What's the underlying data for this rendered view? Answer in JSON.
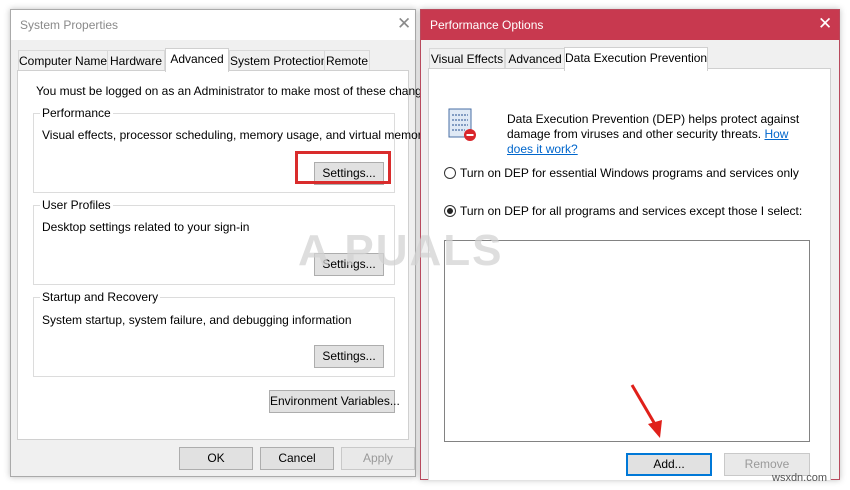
{
  "system_properties": {
    "title": "System Properties",
    "tabs": [
      {
        "label": "Computer Name",
        "active": false
      },
      {
        "label": "Hardware",
        "active": false
      },
      {
        "label": "Advanced",
        "active": true
      },
      {
        "label": "System Protection",
        "active": false
      },
      {
        "label": "Remote",
        "active": false
      }
    ],
    "admin_note": "You must be logged on as an Administrator to make most of these changes.",
    "performance": {
      "legend": "Performance",
      "description": "Visual effects, processor scheduling, memory usage, and virtual memory",
      "button": "Settings..."
    },
    "user_profiles": {
      "legend": "User Profiles",
      "description": "Desktop settings related to your sign-in",
      "button": "Settings..."
    },
    "startup_recovery": {
      "legend": "Startup and Recovery",
      "description": "System startup, system failure, and debugging information",
      "button": "Settings..."
    },
    "env_button": "Environment Variables...",
    "ok": "OK",
    "cancel": "Cancel",
    "apply": "Apply",
    "highlight_color": "#d92c2c"
  },
  "performance_options": {
    "title": "Performance Options",
    "title_bar_color": "#c8394f",
    "tabs": [
      {
        "label": "Visual Effects",
        "active": false
      },
      {
        "label": "Advanced",
        "active": false
      },
      {
        "label": "Data Execution Prevention",
        "active": true
      }
    ],
    "dep_icon": "dep-shield-icon",
    "description_line1": "Data Execution Prevention (DEP) helps protect against",
    "description_line2": "damage from viruses and other security threats.",
    "how_link_1": "How",
    "how_link_2": "does it work?",
    "option_essential": "Turn on DEP for essential Windows programs and services only",
    "option_all": "Turn on DEP for all programs and services except those I select:",
    "selected_option": "all",
    "add_button": "Add...",
    "remove_button": "Remove",
    "arrow_color": "#e0201a"
  },
  "watermark": "A PUALS",
  "site_credit": "wsxdn.com"
}
